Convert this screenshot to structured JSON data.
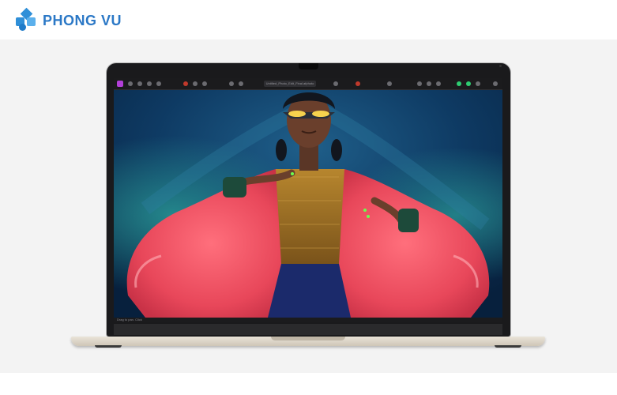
{
  "brand": {
    "name": "PHONG VU",
    "color": "#2b78c6"
  },
  "screen": {
    "window_title": "Untitled_Photo_Edit_Final.afphoto",
    "status_text": "Drag to pan. Click"
  },
  "colors": {
    "laptop_body": "#d8cfbf",
    "bezel": "#1a1a1c",
    "background": "#f3f3f3"
  }
}
